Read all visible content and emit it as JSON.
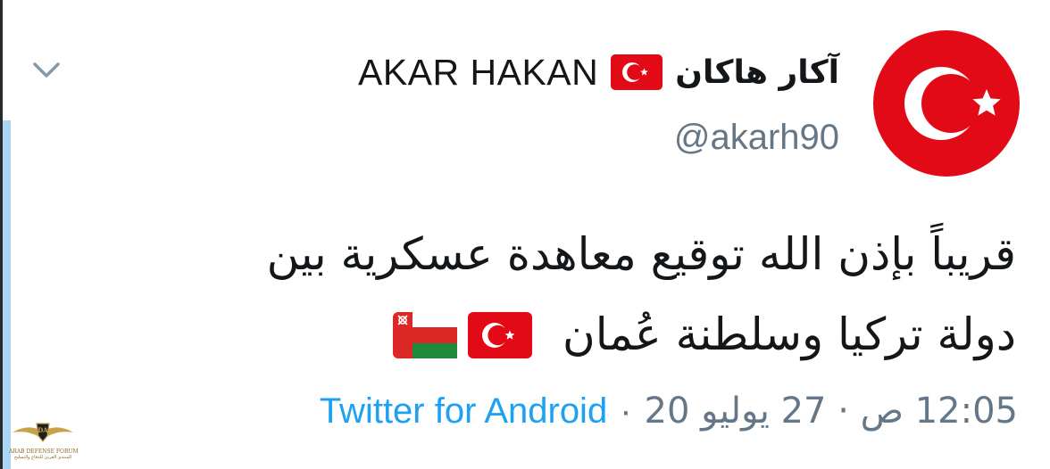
{
  "tweet": {
    "display_name_ar": "آكار هاكان",
    "display_name_en": "AKAR HAKAN",
    "handle": "@akarh90",
    "text_line_1": "قريباً بإذن الله توقيع معاهدة عسكرية بين",
    "text_line_2": "دولة تركيا وسلطنة عُمان",
    "timestamp": "12:05 ص · 27 يوليو 20",
    "separator": "·",
    "client": "Twitter for Android"
  },
  "icons": {
    "menu": "chevron-down-icon",
    "avatar": "crescent-star-avatar",
    "name_flag": "turkey-flag-icon",
    "text_flags": [
      "turkey-flag-icon",
      "oman-flag-icon"
    ]
  },
  "watermark": {
    "badge": "DA",
    "title": "ARAB DEFENSE FORUM",
    "subtitle": "المنتدى العربي للدفاع والتسليح"
  },
  "colors": {
    "name": "#14171a",
    "handle": "#657786",
    "link": "#1da1f2",
    "thread_line": "#a9d6f2",
    "turkey_red": "#e30a17"
  }
}
